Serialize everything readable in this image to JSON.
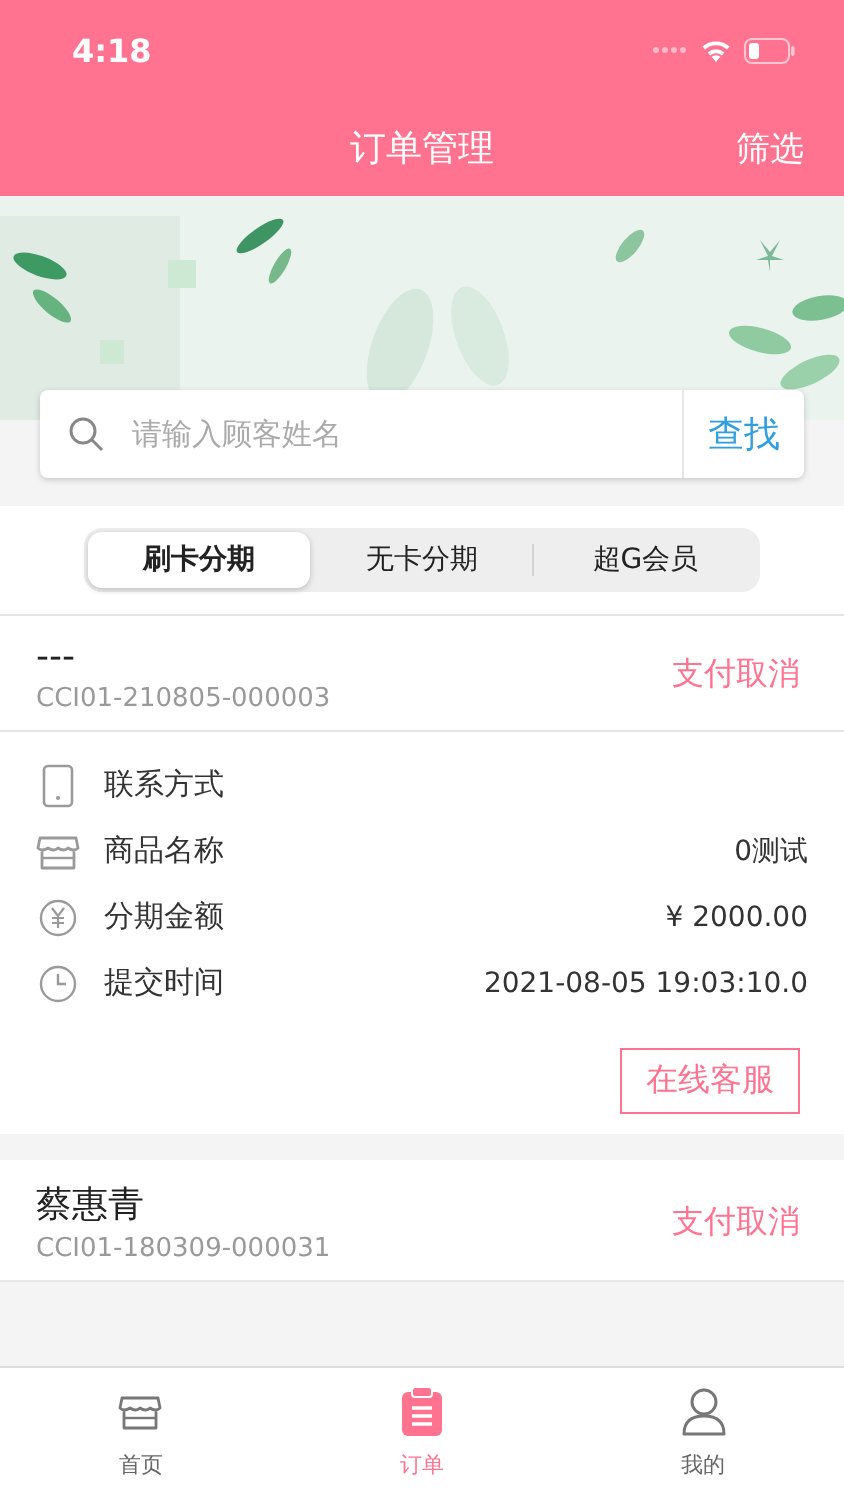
{
  "status_bar": {
    "time": "4:18"
  },
  "nav": {
    "title": "订单管理",
    "action": "筛选"
  },
  "search": {
    "placeholder": "请输入顾客姓名",
    "button": "查找"
  },
  "segments": [
    {
      "label": "刷卡分期",
      "selected": true
    },
    {
      "label": "无卡分期",
      "selected": false
    },
    {
      "label": "超G会员",
      "selected": false
    }
  ],
  "orders": [
    {
      "name": "---",
      "number": "CCI01-210805-000003",
      "status": "支付取消",
      "details": [
        {
          "kind": "phone",
          "label": "联系方式"
        },
        {
          "kind": "shop",
          "label": "商品名称",
          "value": "0测试"
        },
        {
          "kind": "yen",
          "label": "分期金额",
          "value": "¥ 2000.00"
        },
        {
          "kind": "clock",
          "label": "提交时间",
          "value": "2021-08-05 19:03:10.0"
        }
      ],
      "action": "在线客服"
    },
    {
      "name": "蔡惠青",
      "number": "CCI01-180309-000031",
      "status": "支付取消"
    }
  ],
  "tab_bar": [
    {
      "kind": "shop",
      "label": "首页",
      "selected": false
    },
    {
      "kind": "clipboard",
      "label": "订单",
      "selected": true
    },
    {
      "kind": "person",
      "label": "我的",
      "selected": false
    }
  ]
}
